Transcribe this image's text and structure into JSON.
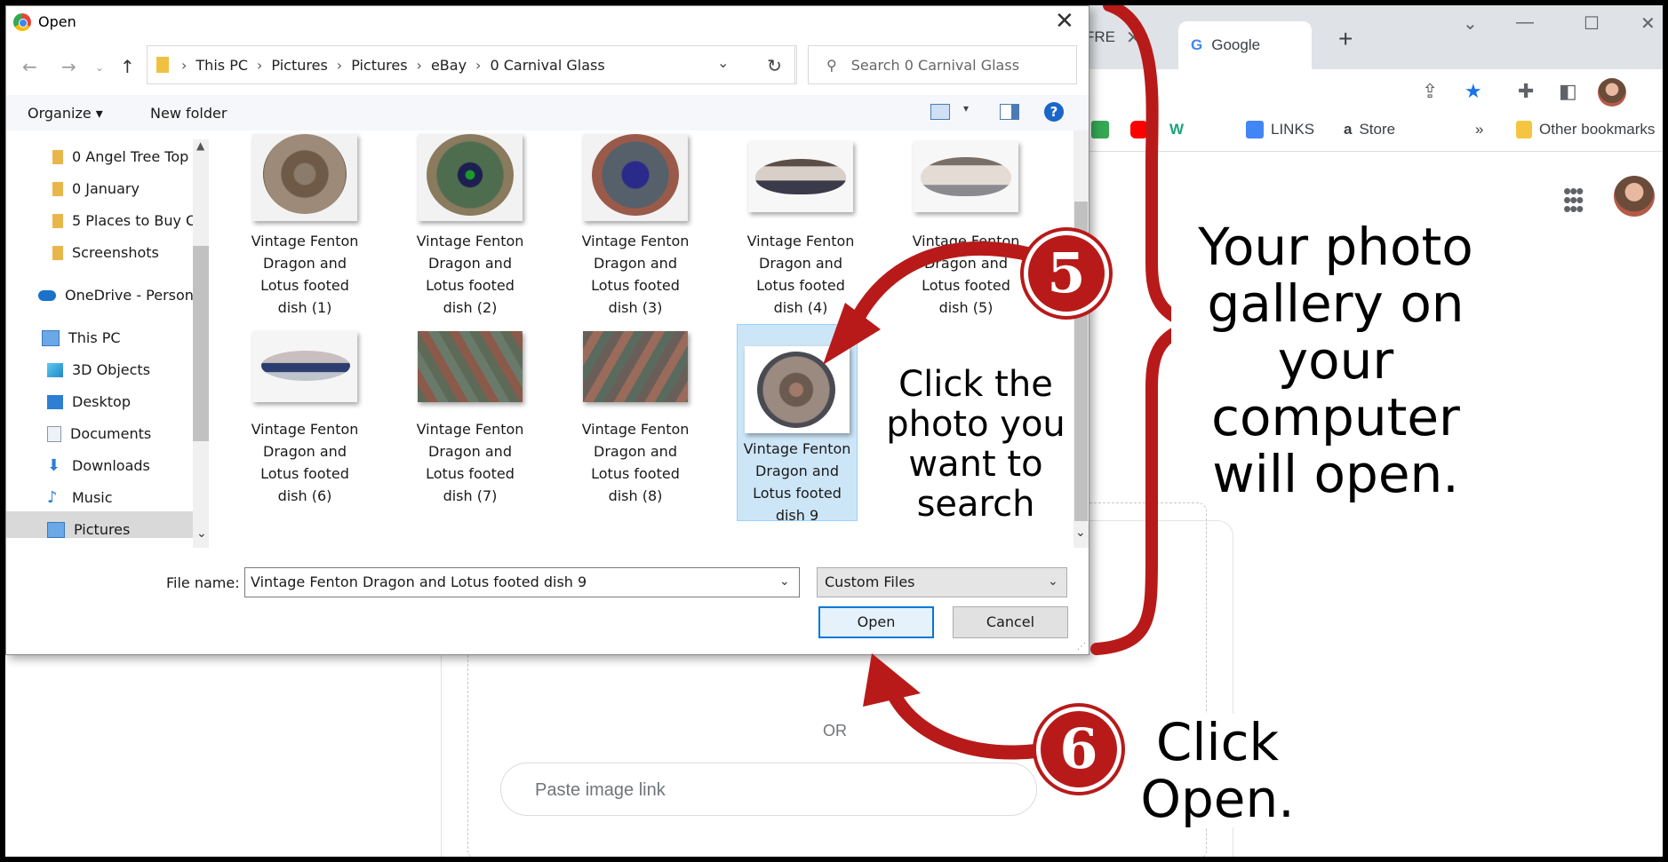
{
  "browser": {
    "tabs": [
      {
        "label": "FRE"
      },
      {
        "label": "Google"
      }
    ],
    "tab_close": "✕",
    "new_tab": "+",
    "bookmarks": [
      {
        "label": "LINKS",
        "color": "#4285f4"
      },
      {
        "label": "Store",
        "color": "#000000"
      }
    ],
    "bookmarks_more": "»",
    "other_bookmarks": "Other bookmarks",
    "lens": {
      "or_label": "OR",
      "paste_placeholder": "Paste image link"
    }
  },
  "dialog": {
    "title": "Open",
    "breadcrumb": [
      "This PC",
      "Pictures",
      "Pictures",
      "eBay",
      "0 Carnival Glass"
    ],
    "search_placeholder": "Search 0 Carnival Glass",
    "toolbar": {
      "organize": "Organize ▾",
      "new_folder": "New folder",
      "help": "?"
    },
    "sidebar": [
      {
        "label": "0 Angel Tree Top",
        "icon": "folder-icon"
      },
      {
        "label": "0 January",
        "icon": "folder-icon"
      },
      {
        "label": "5 Places to Buy C",
        "icon": "folder-icon"
      },
      {
        "label": "Screenshots",
        "icon": "folder-icon"
      },
      {
        "label": "OneDrive - Person",
        "icon": "cloud-icon"
      },
      {
        "label": "This PC",
        "icon": "computer-icon"
      },
      {
        "label": "3D Objects",
        "icon": "cube-icon"
      },
      {
        "label": "Desktop",
        "icon": "desktop-icon"
      },
      {
        "label": "Documents",
        "icon": "document-icon"
      },
      {
        "label": "Downloads",
        "icon": "download-icon"
      },
      {
        "label": "Music",
        "icon": "music-icon"
      },
      {
        "label": "Pictures",
        "icon": "pictures-icon",
        "selected": true
      }
    ],
    "files": [
      {
        "caption": "Vintage Fenton Dragon and Lotus footed dish (1)"
      },
      {
        "caption": "Vintage Fenton Dragon and Lotus footed dish (2)"
      },
      {
        "caption": "Vintage Fenton Dragon and Lotus footed dish (3)"
      },
      {
        "caption": "Vintage Fenton Dragon and Lotus footed dish (4)"
      },
      {
        "caption": "Vintage Fenton Dragon and Lotus footed dish (5)"
      },
      {
        "caption": "Vintage Fenton Dragon and Lotus footed dish (6)"
      },
      {
        "caption": "Vintage Fenton Dragon and Lotus footed dish (7)"
      },
      {
        "caption": "Vintage Fenton Dragon and Lotus footed dish (8)"
      },
      {
        "caption": "Vintage Fenton Dragon and Lotus footed dish 9",
        "selected": true
      }
    ],
    "file_name_label": "File name:",
    "file_name_value": "Vintage Fenton Dragon and Lotus footed dish 9",
    "file_type": "Custom Files",
    "open_button": "Open",
    "cancel_button": "Cancel"
  },
  "annotations": {
    "callout_gallery": "Your photo gallery on your computer will open.",
    "callout_click_photo": "Click the photo you want to search",
    "callout_click_open": "Click Open.",
    "step5": "5",
    "step6": "6",
    "arrow_color": "#b81a1a"
  }
}
